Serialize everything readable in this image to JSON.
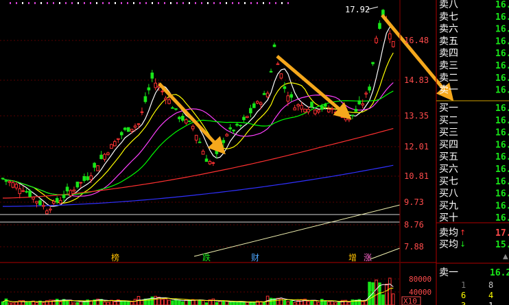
{
  "chart_data": {
    "type": "candlestick",
    "y_ticks": [
      "16.48",
      "14.83",
      "13.35",
      "12.01",
      "10.81",
      "9.73",
      "8.76",
      "7.88"
    ],
    "high_label": "17.92",
    "event_labels": [
      "榜",
      "跌",
      "财",
      "增",
      "涨"
    ],
    "volume_ticks": [
      "80000",
      "40000"
    ],
    "volume_unit": "X10",
    "ylim": [
      7.5,
      18.2
    ]
  },
  "order_book": {
    "sell": [
      {
        "label": "卖八",
        "price": "16."
      },
      {
        "label": "卖七",
        "price": "16."
      },
      {
        "label": "卖六",
        "price": "16."
      },
      {
        "label": "卖五",
        "price": "16."
      },
      {
        "label": "卖四",
        "price": "16."
      },
      {
        "label": "卖三",
        "price": "16."
      },
      {
        "label": "卖二",
        "price": "16."
      },
      {
        "label": "卖一",
        "price": "16."
      }
    ],
    "buy": [
      {
        "label": "买一",
        "price": "16."
      },
      {
        "label": "买二",
        "price": "16."
      },
      {
        "label": "买三",
        "price": "16."
      },
      {
        "label": "买四",
        "price": "16."
      },
      {
        "label": "买五",
        "price": "16."
      },
      {
        "label": "买六",
        "price": "16."
      },
      {
        "label": "买七",
        "price": "16."
      },
      {
        "label": "买八",
        "price": "16."
      },
      {
        "label": "买九",
        "price": "16."
      },
      {
        "label": "买十",
        "price": "16."
      }
    ],
    "avg_sell": {
      "label": "卖均",
      "arrow": "↑",
      "value": "17."
    },
    "avg_buy": {
      "label": "买均",
      "arrow": "↓",
      "value": "15."
    },
    "bottom": {
      "label": "卖一",
      "value": "16.2"
    },
    "stats": [
      "1",
      "8",
      "6",
      "4",
      "3",
      "1"
    ],
    "corner_arrow": "▲"
  },
  "colors": {
    "up": "#ff3232",
    "down": "#19e619",
    "ma5": "#ffffff",
    "ma10": "#ffff00",
    "ma20": "#ff40ff",
    "ma30": "#00ff00",
    "ma60": "#ff3030",
    "ma120": "#3030ff",
    "arrow": "#f5a81c"
  }
}
